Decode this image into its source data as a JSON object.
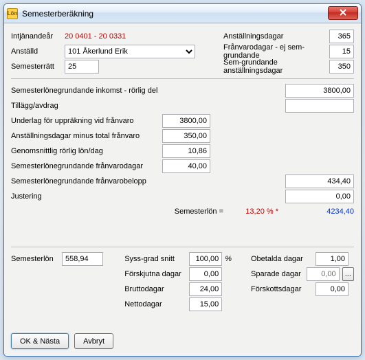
{
  "window": {
    "title": "Semesterberäkning",
    "close_label": "Close"
  },
  "top": {
    "intjanandear_label": "Intjänandeår",
    "intjanandear_value": "20   0401 - 20   0331",
    "anstalld_label": "Anställd",
    "anstalld_value": "101                  Åkerlund Erik",
    "semesterratt_label": "Semesterrätt",
    "semesterratt_value": "25",
    "anstallningsdagar_label": "Anställningsdagar",
    "anstallningsdagar_value": "365",
    "franvarodagar_label": "Frånvarodagar - ej sem-grundande",
    "franvarodagar_value": "15",
    "semgrundande_label": "Sem-grundande anställningsdagar",
    "semgrundande_value": "350"
  },
  "mid": {
    "r1_label": "Semesterlönegrundande inkomst - rörlig del",
    "r1_value": "3800,00",
    "r2_label": "Tillägg/avdrag",
    "r2_value": "",
    "r3_label": "Underlag för uppräkning vid frånvaro",
    "r3_value": "3800,00",
    "r4_label": "Anställningsdagar minus total frånvaro",
    "r4_value": "350,00",
    "r5_label": "Genomsnittlig rörlig lön/dag",
    "r5_value": "10,86",
    "r6_label": "Semesterlönegrundande frånvarodagar",
    "r6_value": "40,00",
    "r7_label": "Semesterlönegrundande frånvarobelopp",
    "r7_value": "434,40",
    "r8_label": "Justering",
    "r8_value": "0,00",
    "sum_label": "Semesterlön =",
    "sum_pct": "13,20 % *",
    "sum_value": "4234,40"
  },
  "bottom": {
    "semesterlon_label": "Semesterlön",
    "semesterlon_value": "558,94",
    "syssgrad_label": "Syss-grad snitt",
    "syssgrad_value": "100,00",
    "syssgrad_unit": "%",
    "forskjutna_label": "Förskjutna dagar",
    "forskjutna_value": "0,00",
    "bruttodagar_label": "Bruttodagar",
    "bruttodagar_value": "24,00",
    "nettodagar_label": "Nettodagar",
    "nettodagar_value": "15,00",
    "obetalda_label": "Obetalda dagar",
    "obetalda_value": "1,00",
    "sparade_label": "Sparade dagar",
    "sparade_value": "0,00",
    "forskotts_label": "Förskottsdagar",
    "forskotts_value": "0,00",
    "ellipsis": "..."
  },
  "buttons": {
    "ok": "OK & Nästa",
    "cancel": "Avbryt"
  }
}
